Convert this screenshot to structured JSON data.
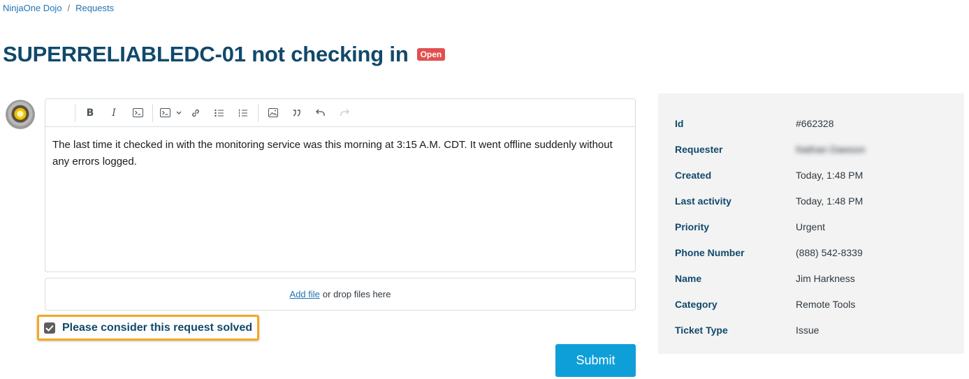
{
  "breadcrumb": {
    "home": "NinjaOne Dojo",
    "separator": "/",
    "section": "Requests"
  },
  "request": {
    "title": "SUPERRELIABLEDC-01 not checking in",
    "status": "Open"
  },
  "colors": {
    "accent": "#1f73b7",
    "title": "#10496b",
    "status_open": "#e34f4f",
    "submit": "#0f9fd8",
    "highlight": "#f5a623"
  },
  "toolbar": {
    "icons": [
      "bold-icon",
      "italic-icon",
      "code-icon",
      "code-block-icon",
      "chevron-down-icon",
      "link-icon",
      "bulleted-list-icon",
      "numbered-list-icon",
      "image-icon",
      "quote-icon",
      "undo-icon",
      "redo-icon"
    ]
  },
  "editor": {
    "text": "The last time it checked in with the monitoring service was this morning at 3:15 A.M. CDT. It went offline suddenly without any errors logged."
  },
  "attachments": {
    "add_file": "Add file",
    "drop_text": "or drop files here"
  },
  "solved": {
    "label": "Please consider this request solved",
    "checked": true
  },
  "submit": {
    "label": "Submit"
  },
  "details": [
    {
      "label": "Id",
      "value": "#662328"
    },
    {
      "label": "Requester",
      "value": "Nathan Dawson",
      "blurred": true
    },
    {
      "label": "Created",
      "value": "Today, 1:48 PM"
    },
    {
      "label": "Last activity",
      "value": "Today, 1:48 PM"
    },
    {
      "label": "Priority",
      "value": "Urgent"
    },
    {
      "label": "Phone Number",
      "value": "(888) 542-8339"
    },
    {
      "label": "Name",
      "value": "Jim Harkness"
    },
    {
      "label": "Category",
      "value": "Remote Tools"
    },
    {
      "label": "Ticket Type",
      "value": "Issue"
    }
  ]
}
